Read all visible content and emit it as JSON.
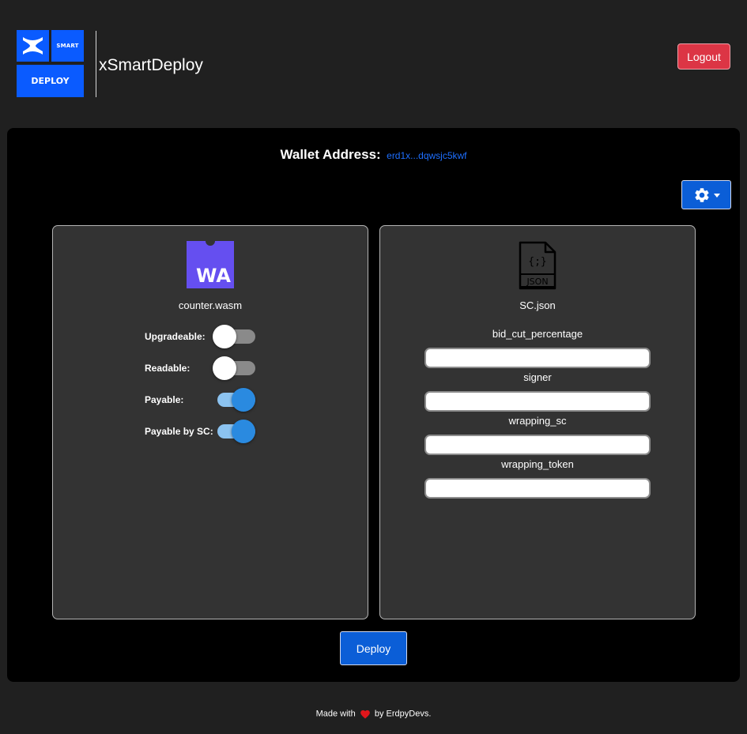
{
  "header": {
    "logo": {
      "top_right": "SMART",
      "bottom": "DEPLOY"
    },
    "app_title": "xSmartDeploy",
    "logout_label": "Logout"
  },
  "wallet": {
    "label": "Wallet Address:",
    "value": "erd1x...dqwsjc5kwf"
  },
  "settings": {
    "icon": "gear-icon",
    "dropdown_icon": "caret-down-icon"
  },
  "wasm_card": {
    "icon_text": "WA",
    "file_name": "counter.wasm",
    "toggles": [
      {
        "label": "Upgradeable:",
        "on": false
      },
      {
        "label": "Readable:",
        "on": false
      },
      {
        "label": "Payable:",
        "on": true
      },
      {
        "label": "Payable by SC:",
        "on": true
      }
    ]
  },
  "json_card": {
    "icon_text": "JSON",
    "icon_symbol": "{;}",
    "file_name": "SC.json",
    "fields": [
      {
        "label": "bid_cut_percentage",
        "value": ""
      },
      {
        "label": "signer",
        "value": ""
      },
      {
        "label": "wrapping_sc",
        "value": ""
      },
      {
        "label": "wrapping_token",
        "value": ""
      }
    ]
  },
  "deploy_label": "Deploy",
  "footer": {
    "prefix": "Made with",
    "suffix": "by ErdpyDevs."
  },
  "colors": {
    "accent": "#0b5ed7",
    "logout": "#dc3545",
    "brand": "#0a5bff",
    "wasm": "#654ff0",
    "heart": "#e0161b"
  }
}
